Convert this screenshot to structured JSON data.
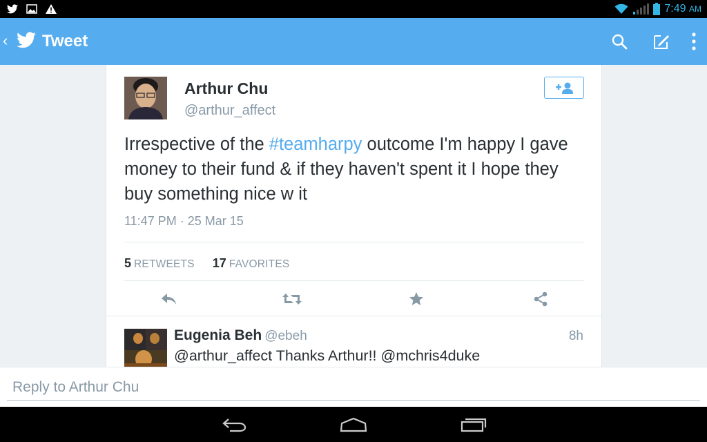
{
  "status_bar": {
    "left_icons": [
      "twitter-notification-icon",
      "image-notification-icon",
      "warning-icon"
    ],
    "right_icons": [
      "wifi-icon",
      "signal-icon",
      "battery-icon"
    ],
    "time": "7:49",
    "ampm": "AM"
  },
  "action_bar": {
    "title": "Tweet",
    "icons": [
      "back-chevron-icon",
      "twitter-bird-icon",
      "search-icon",
      "compose-icon",
      "overflow-menu-icon"
    ]
  },
  "tweet": {
    "author_name": "Arthur Chu",
    "author_handle": "@arthur_affect",
    "text_before": "Irrespective of the ",
    "hashtag": "#teamharpy",
    "text_after": " outcome I'm happy I gave money to their fund & if they haven't spent it I hope they buy something nice w it",
    "timestamp": "11:47 PM · 25 Mar 15",
    "retweets_count": "5",
    "retweets_label": "RETWEETS",
    "favorites_count": "17",
    "favorites_label": "FAVORITES"
  },
  "reply": {
    "author_name": "Eugenia Beh",
    "author_handle": "@ebeh",
    "time": "8h",
    "text": "@arthur_affect Thanks Arthur!! @mchris4duke"
  },
  "reply_box": {
    "placeholder": "Reply to Arthur Chu"
  },
  "colors": {
    "accent": "#55acee",
    "status_time": "#33b5e5",
    "text_primary": "#292f33",
    "text_secondary": "#8899a6",
    "icon_gray": "#8899a6"
  }
}
